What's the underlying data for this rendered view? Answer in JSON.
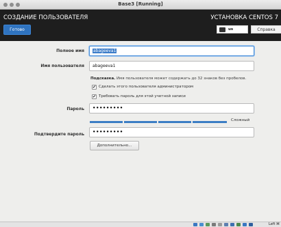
{
  "window": {
    "title": "Base3 [Running]"
  },
  "header": {
    "left_title": "СОЗДАНИЕ ПОЛЬЗОВАТЕЛЯ",
    "done_label": "Готово",
    "right_title": "УСТАНОВКА CENTOS 7",
    "keyboard_layout": "us",
    "help_label": "Справка"
  },
  "form": {
    "full_name": {
      "label": "Полное имя",
      "value": "abageeva1"
    },
    "username": {
      "label": "Имя пользователя",
      "value": "abageeva1"
    },
    "hint_bold": "Подсказка.",
    "hint_text": " Имя пользователя может содержать до 32 знаков без пробелов.",
    "make_admin": {
      "label": "Сделать этого пользователя администратором",
      "checked": true
    },
    "require_password": {
      "label": "Требовать пароль для этой учетной записи",
      "checked": true
    },
    "password": {
      "label": "Пароль",
      "value": "•••••••••"
    },
    "strength": {
      "label": "Сложный",
      "level": 1.0,
      "color": "#3b7dc4"
    },
    "confirm": {
      "label": "Подтвердите пароль",
      "value": "•••••••••"
    },
    "advanced_label": "Дополнительно..."
  },
  "statusbar": {
    "host_key": "Left ⌘"
  },
  "colors": {
    "accent": "#2f73bf",
    "header_bg": "#1e1e1e",
    "content_bg": "#eeeeec"
  }
}
